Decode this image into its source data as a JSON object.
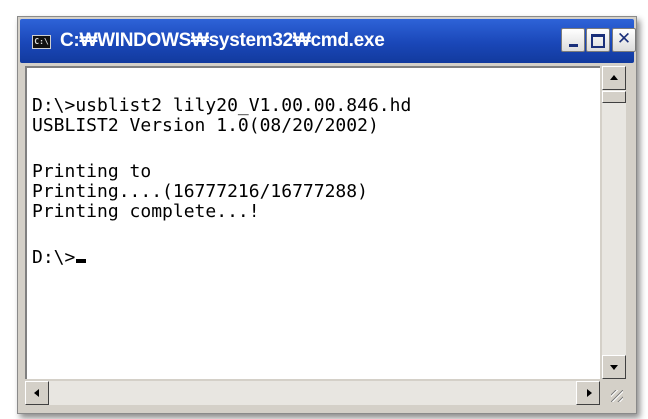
{
  "window": {
    "title": "C:₩WINDOWS₩system32₩cmd.exe",
    "icon": "cmd-icon",
    "icon_text": "C:\\",
    "buttons": {
      "minimize": "minimize-icon",
      "maximize": "maximize-icon",
      "close": "✕"
    }
  },
  "console": {
    "lines": [
      "D:\\>usblist2 lily20_V1.00.00.846.hd",
      "USBLIST2 Version 1.0(08/20/2002)",
      "Printing to",
      "Printing....(16777216/16777288)",
      "Printing complete...!",
      "D:\\>"
    ]
  },
  "scrollbars": {
    "vertical": [
      "up-arrow-icon",
      "down-arrow-icon"
    ],
    "horizontal": [
      "left-arrow-icon",
      "right-arrow-icon"
    ]
  },
  "colors": {
    "titlebar": "#1a47b8",
    "console_bg": "#ffffff",
    "console_text": "#000000",
    "chrome": "#d4d0c8"
  }
}
